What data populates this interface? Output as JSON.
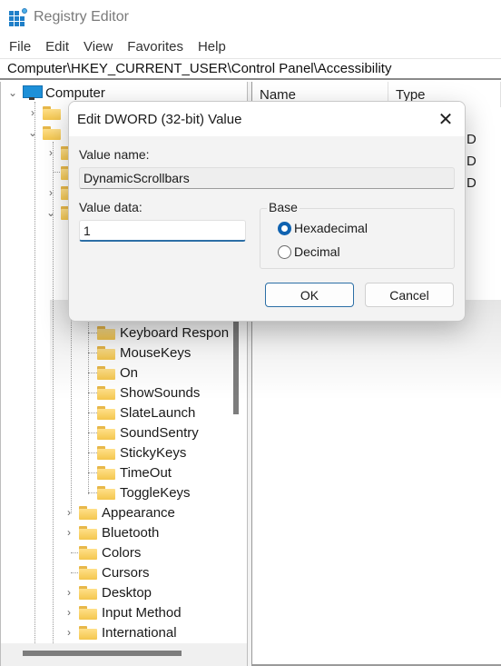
{
  "window": {
    "title": "Registry Editor",
    "accent_color": "#6b3fa0"
  },
  "menu": [
    "File",
    "Edit",
    "View",
    "Favorites",
    "Help"
  ],
  "address": "Computer\\HKEY_CURRENT_USER\\Control Panel\\Accessibility",
  "tree": {
    "root": "Computer",
    "visible_items": [
      "Keyboard Respon",
      "MouseKeys",
      "On",
      "ShowSounds",
      "SlateLaunch",
      "SoundSentry",
      "StickyKeys",
      "TimeOut",
      "ToggleKeys"
    ],
    "siblings": [
      {
        "label": "Appearance",
        "expandable": true
      },
      {
        "label": "Bluetooth",
        "expandable": true
      },
      {
        "label": "Colors",
        "expandable": false
      },
      {
        "label": "Cursors",
        "expandable": false
      },
      {
        "label": "Desktop",
        "expandable": true
      },
      {
        "label": "Input Method",
        "expandable": true
      },
      {
        "label": "International",
        "expandable": true
      }
    ]
  },
  "list": {
    "columns": [
      "Name",
      "Type"
    ],
    "type_cells_partial": [
      "D",
      "D",
      "D"
    ]
  },
  "dialog": {
    "title": "Edit DWORD (32-bit) Value",
    "value_name_label": "Value name:",
    "value_name": "DynamicScrollbars",
    "value_data_label": "Value data:",
    "value_data": "1",
    "base_label": "Base",
    "base_options": [
      "Hexadecimal",
      "Decimal"
    ],
    "base_selected": "Hexadecimal",
    "ok_label": "OK",
    "cancel_label": "Cancel",
    "close_icon": "close-icon"
  }
}
